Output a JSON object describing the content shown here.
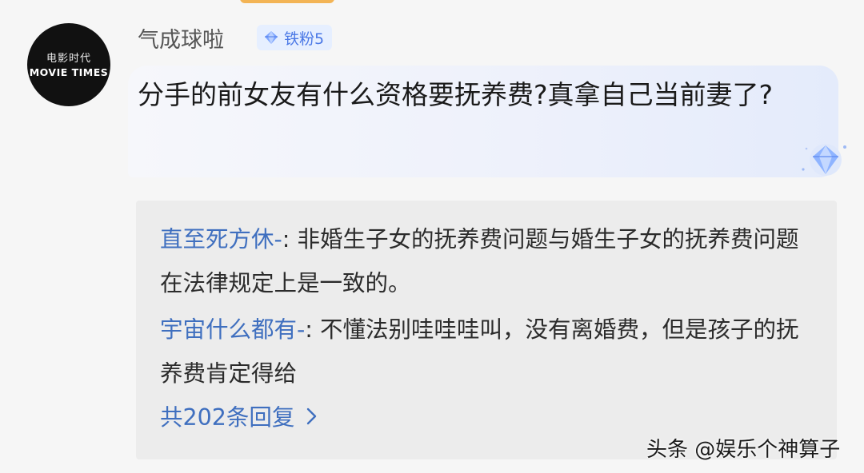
{
  "header": {
    "tab_color": "#f3b455"
  },
  "user": {
    "avatar_title_cn": "电影时代",
    "avatar_title_en": "MOVIE TIMES",
    "avatar_fine_print": "",
    "name": "气成球啦",
    "badge_label": "铁粉5",
    "badge_icon": "diamond-icon",
    "badge_color": "#4a78e6"
  },
  "comment": {
    "text": "分手的前女友有什么资格要抚养费?真拿自己当前妻了?",
    "decoration_icon": "diamond-sparkle-icon"
  },
  "replies": [
    {
      "name": "直至死方休-",
      "text": ": 非婚生子女的抚养费问题与婚生子女的抚养费问题在法律规定上是一致的。"
    },
    {
      "name": "宇宙什么都有-",
      "text": ": 不懂法别哇哇哇叫，没有离婚费，但是孩子的抚养费肯定得给"
    }
  ],
  "more_replies": {
    "label": "共202条回复",
    "icon": "chevron-right-icon"
  },
  "link_color": "#3f6fbf",
  "watermark": "头条 @娱乐个神算子"
}
